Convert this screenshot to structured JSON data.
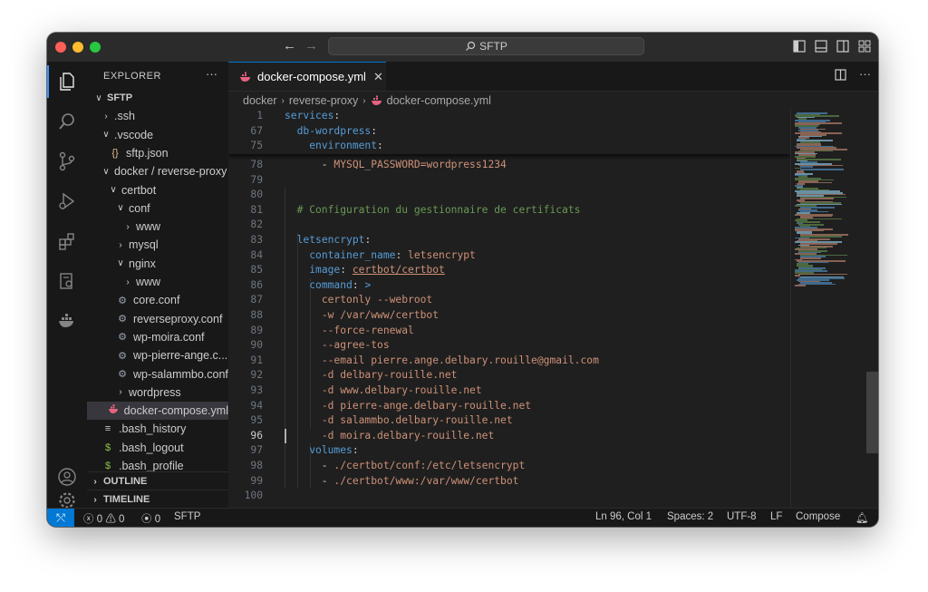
{
  "window": {
    "search_text": "SFTP"
  },
  "sidebar": {
    "title": "EXPLORER",
    "more": "···",
    "tree": [
      {
        "label": "SFTP",
        "chevron": "∨",
        "icon": "",
        "bold": true
      },
      {
        "label": ".ssh",
        "chevron": "›",
        "icon": ""
      },
      {
        "label": ".vscode",
        "chevron": "∨",
        "icon": ""
      },
      {
        "label": "sftp.json",
        "chevron": "",
        "icon": "{}"
      },
      {
        "label": "docker / reverse-proxy",
        "chevron": "∨",
        "icon": ""
      },
      {
        "label": "certbot",
        "chevron": "∨",
        "icon": ""
      },
      {
        "label": "conf",
        "chevron": "∨",
        "icon": ""
      },
      {
        "label": "www",
        "chevron": "›",
        "icon": ""
      },
      {
        "label": "mysql",
        "chevron": "›",
        "icon": ""
      },
      {
        "label": "nginx",
        "chevron": "∨",
        "icon": ""
      },
      {
        "label": "www",
        "chevron": "›",
        "icon": ""
      },
      {
        "label": "core.conf",
        "chevron": "",
        "icon": "⚙"
      },
      {
        "label": "reverseproxy.conf",
        "chevron": "",
        "icon": "⚙"
      },
      {
        "label": "wp-moira.conf",
        "chevron": "",
        "icon": "⚙"
      },
      {
        "label": "wp-pierre-ange.c...",
        "chevron": "",
        "icon": "⚙"
      },
      {
        "label": "wp-salammbo.conf",
        "chevron": "",
        "icon": "⚙"
      },
      {
        "label": "wordpress",
        "chevron": "›",
        "icon": ""
      },
      {
        "label": "docker-compose.yml",
        "chevron": "",
        "icon": "docker",
        "selected": true
      },
      {
        "label": ".bash_history",
        "chevron": "",
        "icon": "≡"
      },
      {
        "label": ".bash_logout",
        "chevron": "",
        "icon": "$"
      },
      {
        "label": ".bash_profile",
        "chevron": "",
        "icon": "$"
      }
    ],
    "sections": [
      "OUTLINE",
      "TIMELINE"
    ]
  },
  "editor": {
    "tab_label": "docker-compose.yml",
    "tab_close": "✕",
    "breadcrumb": [
      "docker",
      "reverse-proxy",
      "docker-compose.yml"
    ],
    "sticky_lines": [
      {
        "num": "1",
        "text": "services:"
      },
      {
        "num": "67",
        "text": "  db-wordpress:"
      },
      {
        "num": "75",
        "text": "    environment:"
      }
    ],
    "lines": [
      {
        "num": "78",
        "text": "      - MYSQL_PASSWORD=wordpress1234"
      },
      {
        "num": "79",
        "text": ""
      },
      {
        "num": "80",
        "text": ""
      },
      {
        "num": "81",
        "text": "  # Configuration du gestionnaire de certificats"
      },
      {
        "num": "82",
        "text": ""
      },
      {
        "num": "83",
        "text": "  letsencrypt:"
      },
      {
        "num": "84",
        "text": "    container_name: letsencrypt"
      },
      {
        "num": "85",
        "text": "    image: certbot/certbot"
      },
      {
        "num": "86",
        "text": "    command: >"
      },
      {
        "num": "87",
        "text": "      certonly --webroot"
      },
      {
        "num": "88",
        "text": "      -w /var/www/certbot"
      },
      {
        "num": "89",
        "text": "      --force-renewal"
      },
      {
        "num": "90",
        "text": "      --agree-tos"
      },
      {
        "num": "91",
        "text": "      --email pierre.ange.delbary.rouille@gmail.com"
      },
      {
        "num": "92",
        "text": "      -d delbary-rouille.net"
      },
      {
        "num": "93",
        "text": "      -d www.delbary-rouille.net"
      },
      {
        "num": "94",
        "text": "      -d pierre-ange.delbary-rouille.net"
      },
      {
        "num": "95",
        "text": "      -d salammbo.delbary-rouille.net"
      },
      {
        "num": "96",
        "text": "      -d moira.delbary-rouille.net"
      },
      {
        "num": "97",
        "text": "    volumes:"
      },
      {
        "num": "98",
        "text": "      - ./certbot/conf:/etc/letsencrypt"
      },
      {
        "num": "99",
        "text": "      - ./certbot/www:/var/www/certbot"
      },
      {
        "num": "100",
        "text": ""
      }
    ]
  },
  "statusbar": {
    "errors": "0",
    "warnings": "0",
    "ports": "0",
    "remote_name": "SFTP",
    "position": "Ln 96, Col 1",
    "spaces": "Spaces: 2",
    "encoding": "UTF-8",
    "eol": "LF",
    "language": "Compose"
  },
  "colors": {
    "accent": "#0078d4",
    "keyword": "#569cd6",
    "string": "#ce9178",
    "comment": "#6a9955"
  }
}
